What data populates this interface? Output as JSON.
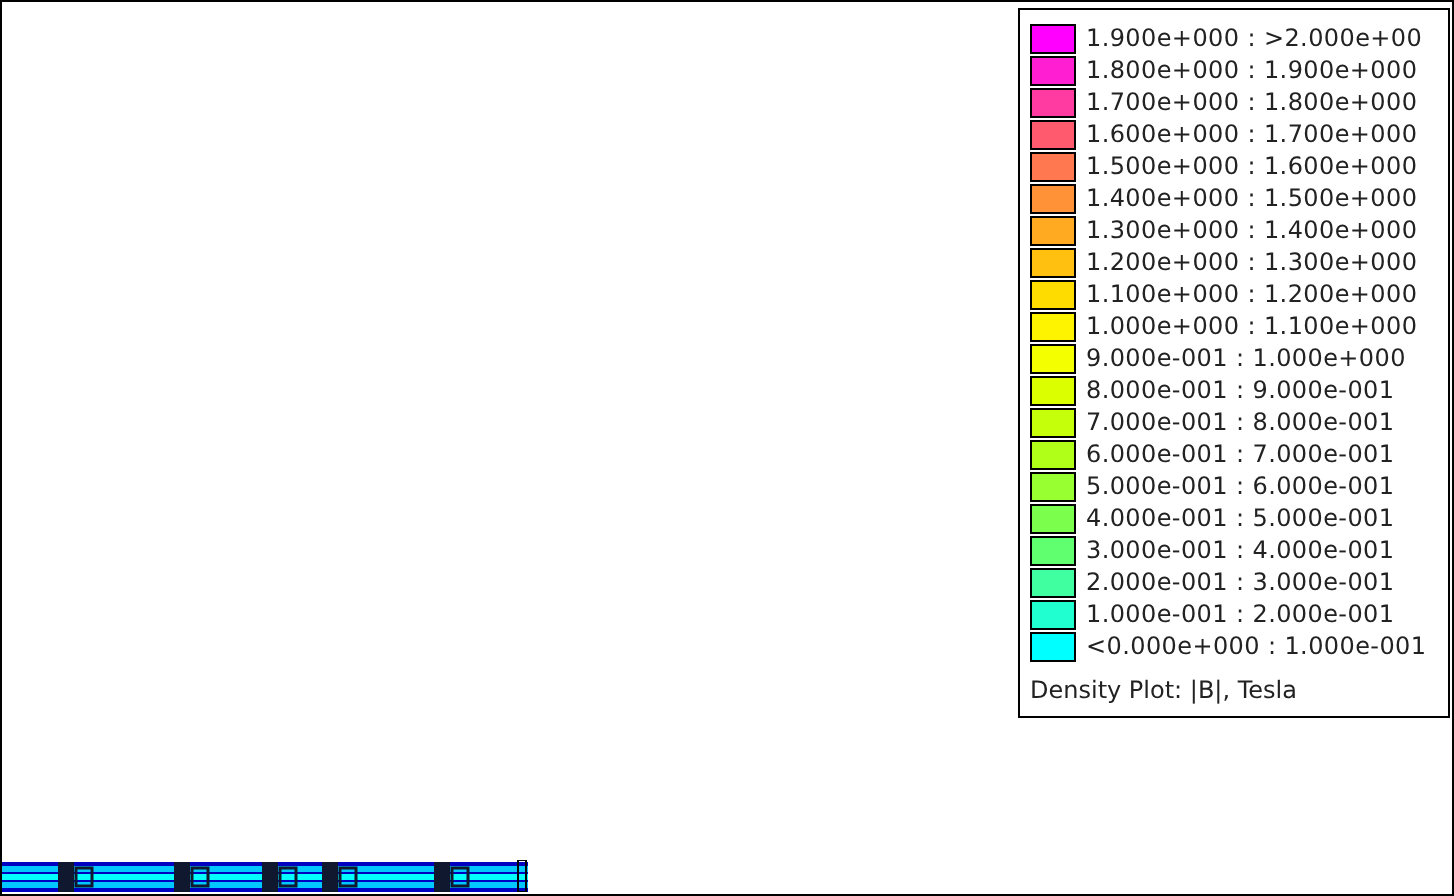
{
  "legend": {
    "entries": [
      {
        "label": "1.900e+000 : >2.000e+00",
        "color": "#ff00ff"
      },
      {
        "label": "1.800e+000 : 1.900e+000",
        "color": "#ff1ed2"
      },
      {
        "label": "1.700e+000 : 1.800e+000",
        "color": "#ff3aa0"
      },
      {
        "label": "1.600e+000 : 1.700e+000",
        "color": "#ff5a6e"
      },
      {
        "label": "1.500e+000 : 1.600e+000",
        "color": "#ff7850"
      },
      {
        "label": "1.400e+000 : 1.500e+000",
        "color": "#ff9236"
      },
      {
        "label": "1.300e+000 : 1.400e+000",
        "color": "#ffaa20"
      },
      {
        "label": "1.200e+000 : 1.300e+000",
        "color": "#ffc010"
      },
      {
        "label": "1.100e+000 : 1.200e+000",
        "color": "#ffdc00"
      },
      {
        "label": "1.000e+000 : 1.100e+000",
        "color": "#fff400"
      },
      {
        "label": "9.000e-001 : 1.000e+000",
        "color": "#f4ff00"
      },
      {
        "label": "8.000e-001 : 9.000e-001",
        "color": "#dcff00"
      },
      {
        "label": "7.000e-001 : 8.000e-001",
        "color": "#c6ff0a"
      },
      {
        "label": "6.000e-001 : 7.000e-001",
        "color": "#b0ff18"
      },
      {
        "label": "5.000e-001 : 6.000e-001",
        "color": "#98ff30"
      },
      {
        "label": "4.000e-001 : 5.000e-001",
        "color": "#7cff4c"
      },
      {
        "label": "3.000e-001 : 4.000e-001",
        "color": "#60ff70"
      },
      {
        "label": "2.000e-001 : 3.000e-001",
        "color": "#40ffa0"
      },
      {
        "label": "1.000e-001 : 2.000e-001",
        "color": "#20ffd0"
      },
      {
        "label": "<0.000e+000 : 1.000e-001",
        "color": "#00ffff"
      }
    ],
    "caption": "Density Plot: |B|, Tesla"
  }
}
